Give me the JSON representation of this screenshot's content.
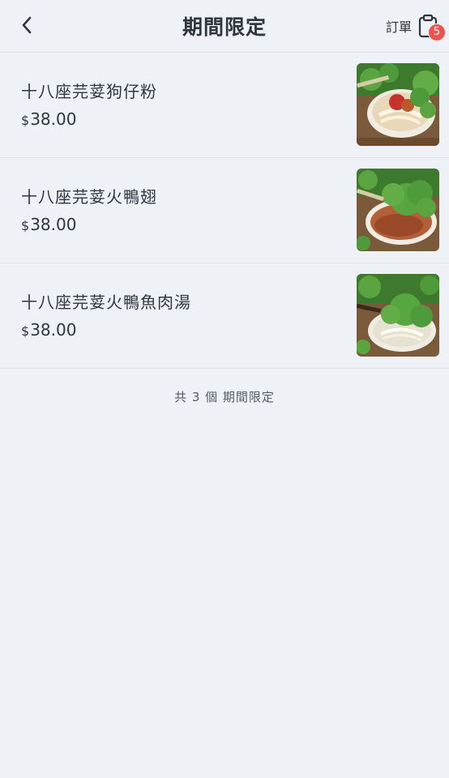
{
  "header": {
    "title": "期間限定",
    "order_label": "訂單",
    "order_badge": "5"
  },
  "items": [
    {
      "name": "十八座芫荽狗仔粉",
      "currency": "$",
      "price": "38.00",
      "thumb": "noodle-dish-image"
    },
    {
      "name": "十八座芫荽火鴨翅",
      "currency": "$",
      "price": "38.00",
      "thumb": "duck-wing-dish-image"
    },
    {
      "name": "十八座芫荽火鴨魚肉湯",
      "currency": "$",
      "price": "38.00",
      "thumb": "fish-soup-dish-image"
    }
  ],
  "footer": {
    "count_text": "共 3 個 期間限定"
  },
  "colors": {
    "background": "#eef2f6",
    "badge": "#ef5350",
    "text": "#2f3640"
  }
}
